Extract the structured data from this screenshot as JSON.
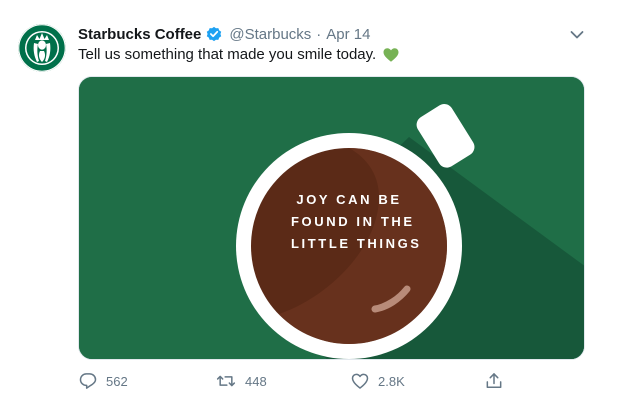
{
  "tweet": {
    "author_name": "Starbucks Coffee",
    "handle": "@Starbucks",
    "separator": "·",
    "date": "Apr 14",
    "text": "Tell us something that made you smile today.",
    "text_emoji": "green-heart",
    "verified": true
  },
  "media": {
    "image_text": [
      "JOY CAN BE",
      "FOUND IN THE",
      "LITTLE THINGS"
    ],
    "colors": {
      "background": "#1f6e47",
      "shadow": "#17583a",
      "cup": "#ffffff",
      "coffee": "#5b2a17",
      "coffee_light": "#6f3620"
    }
  },
  "actions": {
    "replies": "562",
    "retweets": "448",
    "likes": "2.8K"
  },
  "icons": {
    "avatar": "starbucks-siren-logo",
    "verified": "verified-badge-icon",
    "more": "chevron-down-icon",
    "reply": "reply-icon",
    "retweet": "retweet-icon",
    "like": "heart-icon",
    "share": "share-icon"
  },
  "colors": {
    "brand_green": "#00704a",
    "verified_blue": "#1da1f2",
    "meta_gray": "#657786",
    "text": "#14171a"
  }
}
